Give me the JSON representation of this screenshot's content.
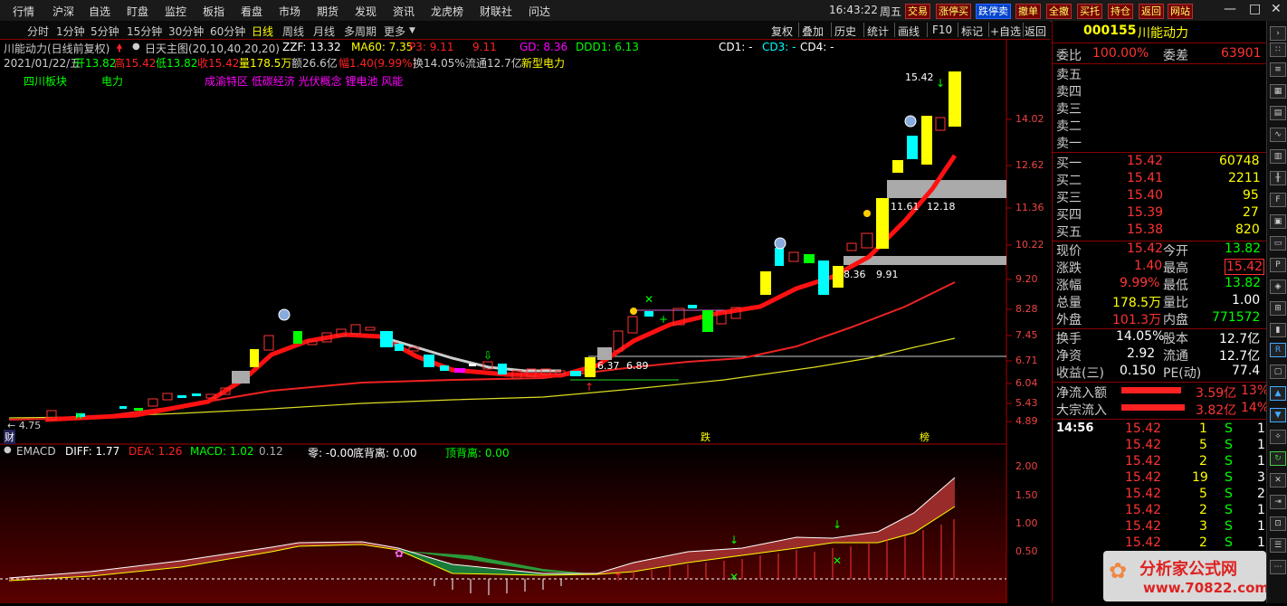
{
  "menubar": {
    "items": [
      "行情",
      "沪深",
      "自选",
      "盯盘",
      "监控",
      "板指",
      "看盘",
      "市场",
      "期货",
      "发现",
      "资讯",
      "龙虎榜",
      "财联社",
      "问达"
    ],
    "clock": "16:43:22",
    "weekday": "周五",
    "tools": [
      "交易",
      "涨停买",
      "跌停卖",
      "撤单",
      "全撤",
      "买托",
      "持仓",
      "返回",
      "网站"
    ],
    "win_min": "—",
    "win_max": "□",
    "win_close": "✕"
  },
  "periodbar": {
    "items": [
      "分时",
      "1分钟",
      "5分钟",
      "15分钟",
      "30分钟",
      "60分钟",
      "日线",
      "周线",
      "月线",
      "多周期",
      "更多"
    ],
    "active": "日线",
    "right_items": [
      "复权",
      "叠加",
      "历史",
      "统计",
      "画线",
      "F10",
      "标记",
      "+自选",
      "返回"
    ]
  },
  "kline": {
    "title": "川能动力(日线前复权)",
    "main_indicator": "日天主图(20,10,40,20,20)",
    "zzf": "ZZF: 13.32",
    "ma60": "MA60: 7.35",
    "p3": "P3: 9.11",
    "p3b": "9.11",
    "gd": "GD: 8.36",
    "ddd1": "DDD1: 6.13",
    "cd1": "CD1: -",
    "cd3": "CD3: -",
    "cd4": "CD4: -",
    "date": "2021/01/22/五",
    "open": "开13.82",
    "high": "高15.42",
    "low": "低13.82",
    "close": "收15.42",
    "volume": "量178.5万",
    "amount": "额26.6亿",
    "range": "幅1.40(9.99%)",
    "turnover": "换14.05%",
    "float_cap": "流通12.7亿",
    "tag": "新型电力",
    "sectors": [
      "四川板块",
      "电力",
      "成渝特区 低碳经济 光伏概念 锂电池 风能"
    ],
    "price_labels": [
      "15.42",
      "11.61",
      "12.18",
      "8.36",
      "9.91",
      "6.37",
      "6.89",
      "4.75"
    ],
    "markers": [
      "财",
      "跌",
      "榜"
    ]
  },
  "yaxis": {
    "main": [
      "14.02",
      "12.62",
      "11.36",
      "10.22",
      "9.20",
      "8.28",
      "7.45",
      "6.71",
      "6.04",
      "5.43",
      "4.89"
    ],
    "sub": [
      "2.00",
      "1.50",
      "1.00",
      "0.50"
    ]
  },
  "macd": {
    "name": "EMACD",
    "diff": "DIFF: 1.77",
    "dea": "DEA: 1.26",
    "macd": "MACD: 1.02",
    "extra": "0.12",
    "zero": "零: -0.00",
    "bottom_div": "底背离: 0.00",
    "top_div": "顶背离: 0.00"
  },
  "quote": {
    "code": "000155",
    "name": "川能动力",
    "weibi_label": "委比",
    "weibi": "100.00%",
    "weicha_label": "委差",
    "weicha": "63901",
    "sell": [
      {
        "label": "卖五",
        "price": "",
        "vol": ""
      },
      {
        "label": "卖四",
        "price": "",
        "vol": ""
      },
      {
        "label": "卖三",
        "price": "",
        "vol": ""
      },
      {
        "label": "卖二",
        "price": "",
        "vol": ""
      },
      {
        "label": "卖一",
        "price": "",
        "vol": ""
      }
    ],
    "buy": [
      {
        "label": "买一",
        "price": "15.42",
        "vol": "60748"
      },
      {
        "label": "买二",
        "price": "15.41",
        "vol": "2211"
      },
      {
        "label": "买三",
        "price": "15.40",
        "vol": "95"
      },
      {
        "label": "买四",
        "price": "15.39",
        "vol": "27"
      },
      {
        "label": "买五",
        "price": "15.38",
        "vol": "820"
      }
    ],
    "stats": [
      {
        "l1": "现价",
        "v1": "15.42",
        "l2": "今开",
        "v2": "13.82"
      },
      {
        "l1": "涨跌",
        "v1": "1.40",
        "l2": "最高",
        "v2": "15.42"
      },
      {
        "l1": "涨幅",
        "v1": "9.99%",
        "l2": "最低",
        "v2": "13.82"
      },
      {
        "l1": "总量",
        "v1": "178.5万",
        "l2": "量比",
        "v2": "1.00"
      },
      {
        "l1": "外盘",
        "v1": "101.3万",
        "l2": "内盘",
        "v2": "771572"
      }
    ],
    "stats2": [
      {
        "l1": "换手",
        "v1": "14.05%",
        "l2": "股本",
        "v2": "12.7亿"
      },
      {
        "l1": "净资",
        "v1": "2.92",
        "l2": "流通",
        "v2": "12.7亿"
      },
      {
        "l1": "收益(三)",
        "v1": "0.150",
        "l2": "PE(动)",
        "v2": "77.4"
      }
    ],
    "flow": [
      {
        "label": "净流入额",
        "value": "3.59亿",
        "pct": "13%"
      },
      {
        "label": "大宗流入",
        "value": "3.82亿",
        "pct": "14%"
      }
    ],
    "ticks_time": "14:56",
    "ticks": [
      {
        "price": "15.42",
        "vol": "1",
        "flag": "S",
        "n": "1"
      },
      {
        "price": "15.42",
        "vol": "5",
        "flag": "S",
        "n": "1"
      },
      {
        "price": "15.42",
        "vol": "2",
        "flag": "S",
        "n": "1"
      },
      {
        "price": "15.42",
        "vol": "19",
        "flag": "S",
        "n": "3"
      },
      {
        "price": "15.42",
        "vol": "5",
        "flag": "S",
        "n": "2"
      },
      {
        "price": "15.42",
        "vol": "2",
        "flag": "S",
        "n": "1"
      },
      {
        "price": "15.42",
        "vol": "3",
        "flag": "S",
        "n": "1"
      },
      {
        "price": "15.42",
        "vol": "2",
        "flag": "S",
        "n": "1"
      }
    ]
  },
  "watermark": {
    "name": "分析家公式网",
    "url": "www.70822.com"
  },
  "colors": {
    "up": "#ff3333",
    "down": "#00ffff",
    "yellow": "#ffff00",
    "accent": "#cc0000"
  }
}
